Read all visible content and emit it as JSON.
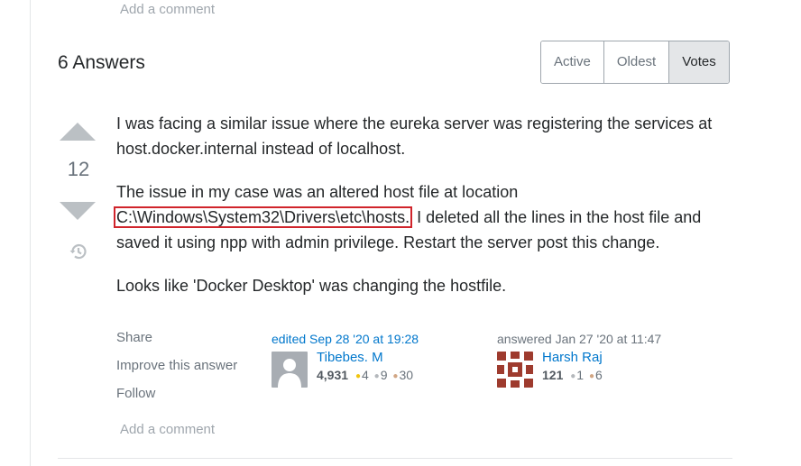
{
  "top_comment": {
    "label": "Add a comment"
  },
  "answers_header": {
    "count_label": "6 Answers",
    "sort_tabs": [
      {
        "label": "Active"
      },
      {
        "label": "Oldest"
      },
      {
        "label": "Votes",
        "selected": true
      }
    ]
  },
  "answer": {
    "vote_count": "12",
    "body": {
      "p1": "I was facing a similar issue where the eureka server was registering the services at host.docker.internal instead of localhost.",
      "p2_before": "The issue in my case was an altered host file at location ",
      "p2_path": "C:\\Windows\\System32\\Drivers\\etc\\hosts.",
      "p2_after": " I deleted all the lines in the host file and saved it using npp with admin privilege. Restart the server post this change.",
      "p3": "Looks like 'Docker Desktop' was changing the hostfile."
    },
    "menu": {
      "share": "Share",
      "improve": "Improve this answer",
      "follow": "Follow"
    },
    "edited": {
      "action": "edited Sep 28 '20 at 19:28",
      "user_name": "Tibebes. M",
      "reputation": "4,931",
      "gold": "4",
      "silver": "9",
      "bronze": "30",
      "avatar_icon": "default-user-icon"
    },
    "owner": {
      "action": "answered Jan 27 '20 at 11:47",
      "user_name": "Harsh Raj",
      "reputation": "121",
      "silver": "1",
      "bronze": "6",
      "avatar_icon": "identicon-avatar"
    },
    "add_comment": "Add a comment"
  },
  "colors": {
    "link": "#0077cc",
    "muted": "#6a737c",
    "highlight_border": "#d0242b",
    "gold": "#f1c40f",
    "silver": "#b4b8bc",
    "bronze": "#d1a684"
  }
}
